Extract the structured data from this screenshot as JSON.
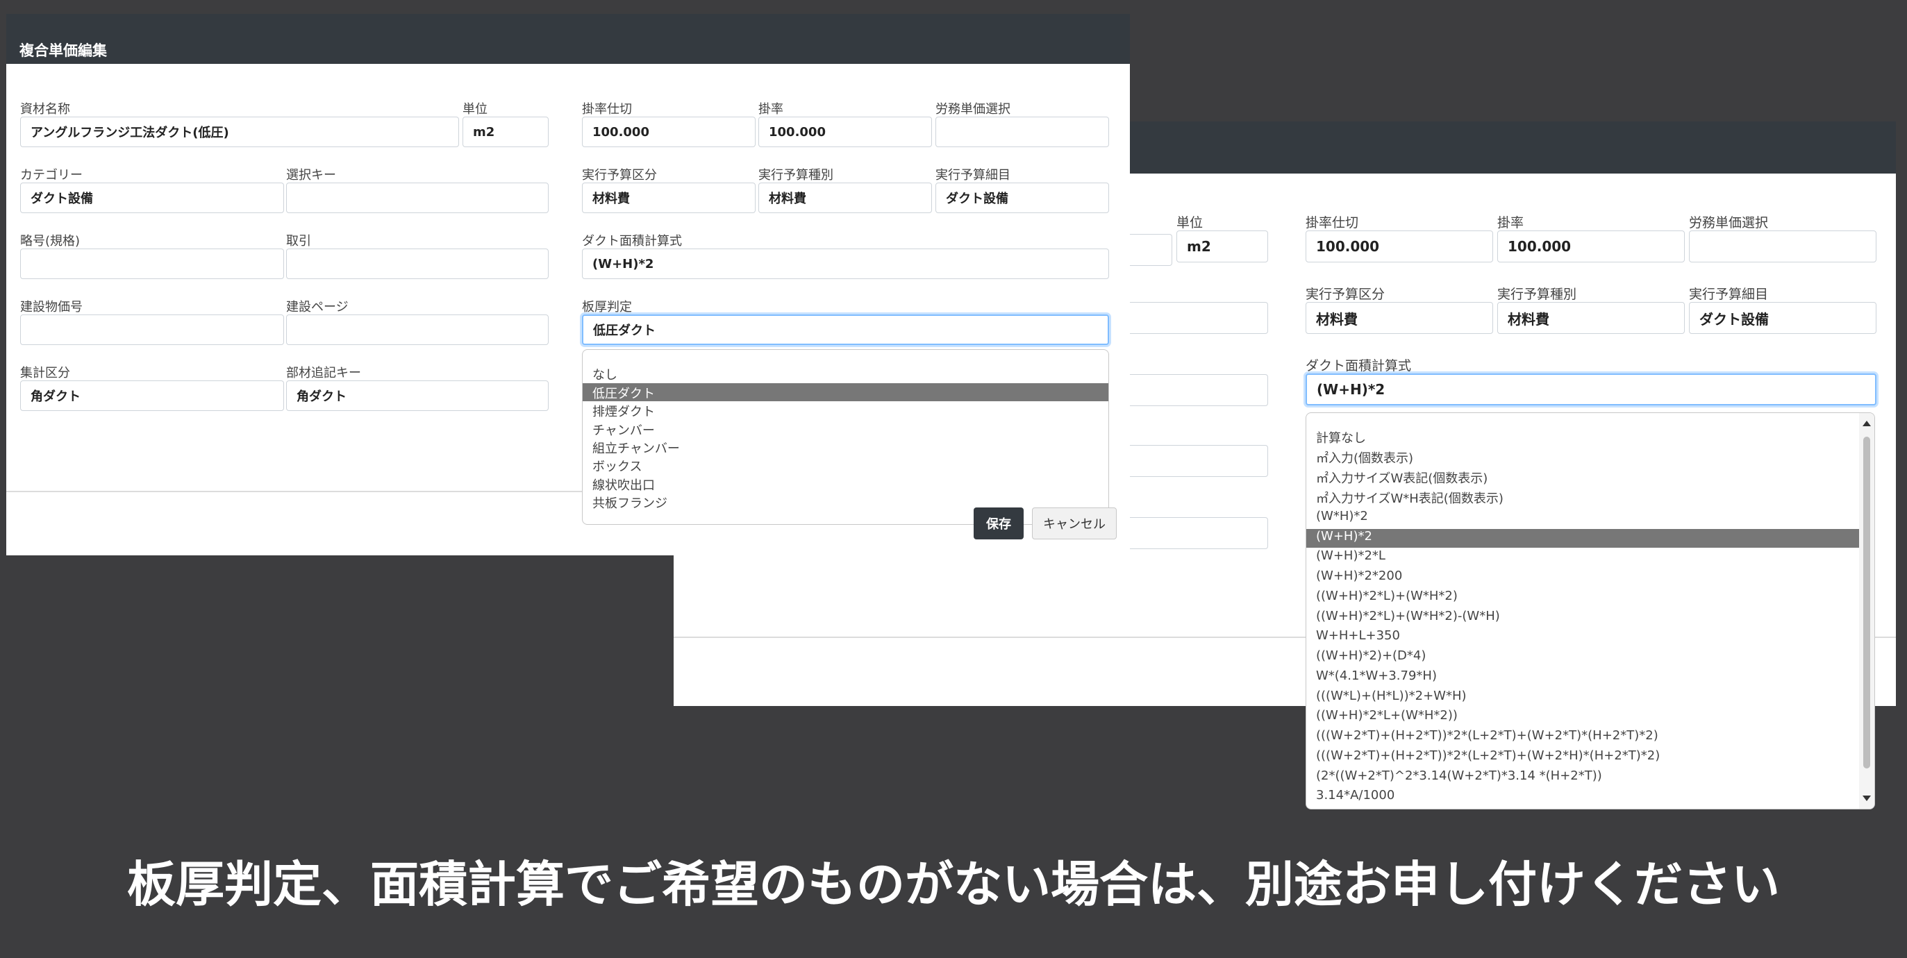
{
  "dialog_left": {
    "title": "複合単価編集",
    "fields": {
      "material_name": {
        "label": "資材名称",
        "value": "アングルフランジ工法ダクト(低圧)"
      },
      "unit": {
        "label": "単位",
        "value": "m2"
      },
      "rate_cut": {
        "label": "掛率仕切",
        "value": "100.000"
      },
      "rate": {
        "label": "掛率",
        "value": "100.000"
      },
      "labor_select": {
        "label": "労務単価選択",
        "value": ""
      },
      "category": {
        "label": "カテゴリー",
        "value": "ダクト設備"
      },
      "select_key": {
        "label": "選択キー",
        "value": ""
      },
      "budget_class": {
        "label": "実行予算区分",
        "value": "材料費"
      },
      "budget_type": {
        "label": "実行予算種別",
        "value": "材料費"
      },
      "budget_detail": {
        "label": "実行予算細目",
        "value": "ダクト設備"
      },
      "abbrev": {
        "label": "略号(規格)",
        "value": ""
      },
      "trade": {
        "label": "取引",
        "value": ""
      },
      "duct_area_formula": {
        "label": "ダクト面積計算式",
        "value": "(W+H)*2"
      },
      "bldg_price_no": {
        "label": "建設物価号",
        "value": ""
      },
      "bldg_page": {
        "label": "建設ページ",
        "value": ""
      },
      "thickness": {
        "label": "板厚判定",
        "value": "低圧ダクト"
      },
      "tally_class": {
        "label": "集計区分",
        "value": "角ダクト"
      },
      "parts_key": {
        "label": "部材追記キー",
        "value": "角ダクト"
      }
    },
    "thickness_options": [
      "なし",
      "低圧ダクト",
      "排煙ダクト",
      "チャンバー",
      "組立チャンバー",
      "ボックス",
      "線状吹出口",
      "共板フランジ"
    ],
    "selected_option": "低圧ダクト",
    "buttons": {
      "save": "保存",
      "cancel": "キャンセル"
    }
  },
  "dialog_right": {
    "fields": {
      "unit": {
        "label": "単位",
        "value": "m2"
      },
      "rate_cut": {
        "label": "掛率仕切",
        "value": "100.000"
      },
      "rate": {
        "label": "掛率",
        "value": "100.000"
      },
      "labor_select": {
        "label": "労務単価選択",
        "value": ""
      },
      "budget_class": {
        "label": "実行予算区分",
        "value": "材料費"
      },
      "budget_type": {
        "label": "実行予算種別",
        "value": "材料費"
      },
      "budget_detail": {
        "label": "実行予算細目",
        "value": "ダクト設備"
      },
      "duct_area_formula": {
        "label": "ダクト面積計算式",
        "value": "(W+H)*2"
      }
    },
    "formula_options": [
      "計算なし",
      "㎡入力(個数表示)",
      "㎡入力サイズW表記(個数表示)",
      "㎡入力サイズW*H表記(個数表示)",
      "(W*H)*2",
      "(W+H)*2",
      "(W+H)*2*L",
      "(W+H)*2*200",
      "((W+H)*2*L)+(W*H*2)",
      "((W+H)*2*L)+(W*H*2)-(W*H)",
      "W+H+L+350",
      "((W+H)*2)+(D*4)",
      "W*(4.1*W+3.79*H)",
      "(((W*L)+(H*L))*2+W*H)",
      "((W+H)*2*L+(W*H*2))",
      "(((W+2*T)+(H+2*T))*2*(L+2*T)+(W+2*T)*(H+2*T)*2)",
      "(((W+2*T)+(H+2*T))*2*(L+2*T)+(W+2*H)*(H+2*T)*2)",
      "(2*((W+2*T)^2*3.14(W+2*T)*3.14 *(H+2*T))",
      "3.14*A/1000"
    ],
    "selected_option": "(W+H)*2"
  },
  "caption": "板厚判定、面積計算でご希望のものがない場合は、別途お申し付けください"
}
